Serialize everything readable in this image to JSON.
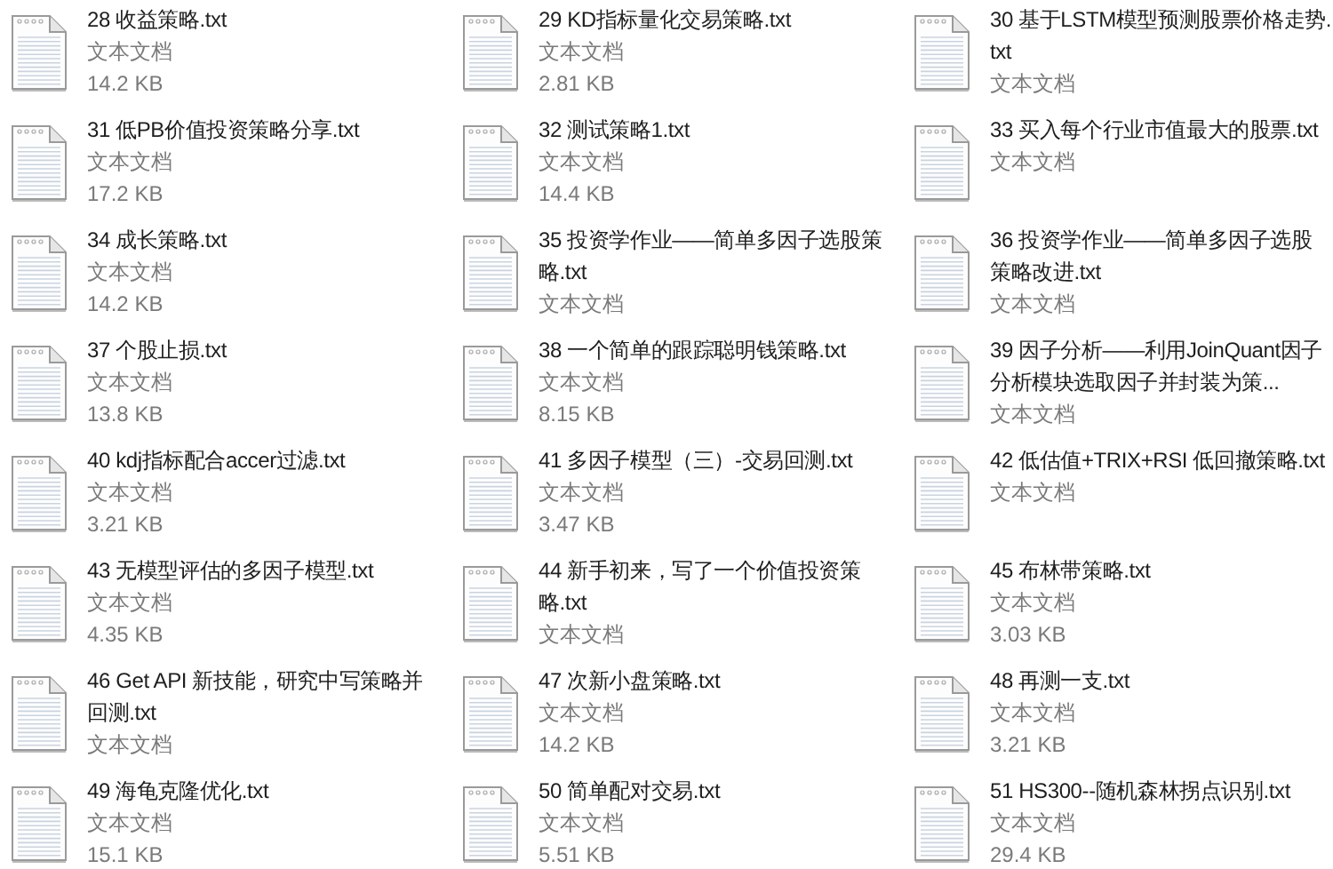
{
  "files": [
    {
      "name": "28 收益策略.txt",
      "type": "文本文档",
      "size": "14.2 KB"
    },
    {
      "name": "29 KD指标量化交易策略.txt",
      "type": "文本文档",
      "size": "2.81 KB"
    },
    {
      "name": "30 基于LSTM模型预测股票价格走势.txt",
      "type": "文本文档"
    },
    {
      "name": "31 低PB价值投资策略分享.txt",
      "type": "文本文档",
      "size": "17.2 KB"
    },
    {
      "name": "32 测试策略1.txt",
      "type": "文本文档",
      "size": "14.4 KB"
    },
    {
      "name": "33 买入每个行业市值最大的股票.txt",
      "type": "文本文档"
    },
    {
      "name": "34 成长策略.txt",
      "type": "文本文档",
      "size": "14.2 KB"
    },
    {
      "name": "35 投资学作业——简单多因子选股策略.txt",
      "type": "文本文档"
    },
    {
      "name": "36 投资学作业——简单多因子选股策略改进.txt",
      "type": "文本文档"
    },
    {
      "name": "37 个股止损.txt",
      "type": "文本文档",
      "size": "13.8 KB"
    },
    {
      "name": "38 一个简单的跟踪聪明钱策略.txt",
      "type": "文本文档",
      "size": "8.15 KB"
    },
    {
      "name": "39 因子分析——利用JoinQuant因子分析模块选取因子并封装为策...",
      "type": "文本文档"
    },
    {
      "name": "40 kdj指标配合accer过滤.txt",
      "type": "文本文档",
      "size": "3.21 KB"
    },
    {
      "name": "41 多因子模型（三）-交易回测.txt",
      "type": "文本文档",
      "size": "3.47 KB"
    },
    {
      "name": "42 低估值+TRIX+RSI 低回撤策略.txt",
      "type": "文本文档"
    },
    {
      "name": "43 无模型评估的多因子模型.txt",
      "type": "文本文档",
      "size": "4.35 KB"
    },
    {
      "name": "44 新手初来，写了一个价值投资策略.txt",
      "type": "文本文档"
    },
    {
      "name": "45 布林带策略.txt",
      "type": "文本文档",
      "size": "3.03 KB"
    },
    {
      "name": "46 Get API 新技能，研究中写策略并回测.txt",
      "type": "文本文档"
    },
    {
      "name": "47 次新小盘策略.txt",
      "type": "文本文档",
      "size": "14.2 KB"
    },
    {
      "name": "48 再测一支.txt",
      "type": "文本文档",
      "size": "3.21 KB"
    },
    {
      "name": "49 海龟克隆优化.txt",
      "type": "文本文档",
      "size": "15.1 KB"
    },
    {
      "name": "50 简单配对交易.txt",
      "type": "文本文档",
      "size": "5.51 KB"
    },
    {
      "name": "51 HS300--随机森林拐点识别.txt",
      "type": "文本文档",
      "size": "29.4 KB"
    }
  ]
}
